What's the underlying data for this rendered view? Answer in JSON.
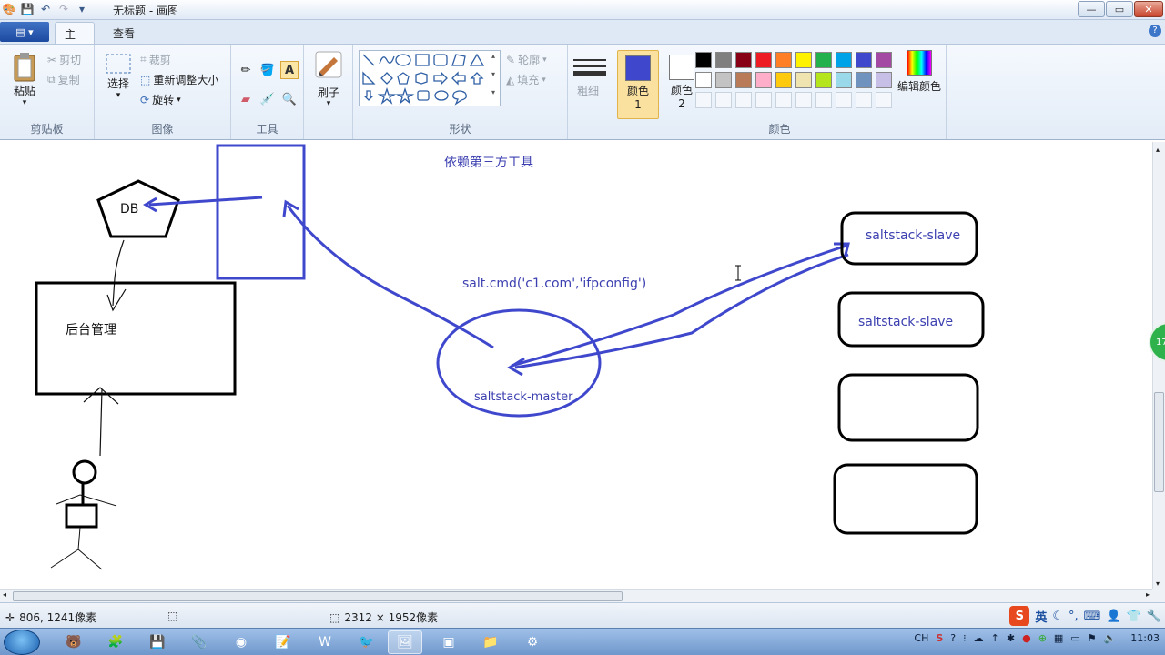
{
  "window": {
    "title": "无标题 - 画图",
    "minimize": "—",
    "maximize": "▭",
    "close": "✕"
  },
  "tabs": {
    "file": "▤ ▾",
    "home": "主页",
    "view": "查看",
    "help": "?"
  },
  "ribbon": {
    "clipboard": {
      "label": "剪贴板",
      "paste": "粘贴",
      "cut": "剪切",
      "copy": "复制"
    },
    "image": {
      "label": "图像",
      "select": "选择",
      "crop": "裁剪",
      "resize": "重新调整大小",
      "rotate": "旋转"
    },
    "tools": {
      "label": "工具"
    },
    "brushes": {
      "label": "刷子"
    },
    "shapes": {
      "label": "形状",
      "outline": "轮廓",
      "fill": "填充"
    },
    "size": {
      "label": "粗细"
    },
    "colors": {
      "label": "颜色",
      "color1": "颜色 1",
      "color2": "颜色 2",
      "edit": "编辑颜色",
      "color1_value": "#3f48cc",
      "color2_value": "#ffffff",
      "palette": [
        "#000000",
        "#7f7f7f",
        "#880015",
        "#ed1c24",
        "#ff7f27",
        "#fff200",
        "#22b14c",
        "#00a2e8",
        "#3f48cc",
        "#a349a4",
        "#ffffff",
        "#c3c3c3",
        "#b97a57",
        "#ffaec9",
        "#ffc90e",
        "#efe4b0",
        "#b5e61d",
        "#99d9ea",
        "#7092be",
        "#c8bfe7"
      ]
    }
  },
  "canvas": {
    "note_top": "依赖第三方工具",
    "db_label": "DB",
    "admin_label": "后台管理",
    "cmd_label": "salt.cmd('c1.com','ifpconfig')",
    "master_label": "saltstack-master",
    "slave1_label": "saltstack-slave",
    "slave2_label": "saltstack-slave",
    "stroke_color": "#3f48cc"
  },
  "statusbar": {
    "cursor_pos": "806, 1241像素",
    "image_size": "2312 × 1952像素",
    "ime_lang": "英"
  },
  "taskbar": {
    "tray_lang": "CH",
    "clock": "11:03"
  },
  "side_badge": "17"
}
